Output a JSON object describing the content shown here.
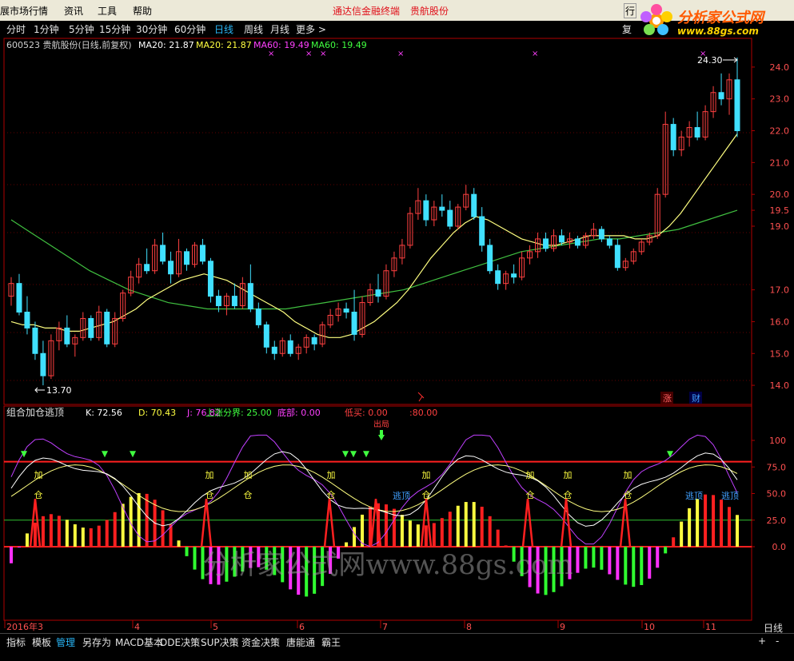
{
  "menu": {
    "items": [
      "展市场行情",
      "资讯",
      "工具",
      "帮助"
    ],
    "center_title": "通达信金融终端",
    "stock_name": "贵航股份",
    "right_label": "行"
  },
  "logo": {
    "line1": "分析家公式网",
    "line2": "www.88gs.com"
  },
  "periods": [
    "分时",
    "1分钟",
    "5分钟",
    "15分钟",
    "30分钟",
    "60分钟",
    "日线",
    "周线",
    "月线",
    "更多 >"
  ],
  "period_selected": 6,
  "right_side_label": "复",
  "main_panel": {
    "info_code": "600523 贵航股份(日线,前复权)",
    "ma_labels": [
      {
        "text": "MA20: 21.87",
        "color": "#ffffff"
      },
      {
        "text": "MA20: 21.87",
        "color": "#ffff40"
      },
      {
        "text": "MA60: 19.49",
        "color": "#ff40ff"
      },
      {
        "text": "MA60: 19.49",
        "color": "#40ff40"
      }
    ],
    "high_label": "24.30",
    "low_label": "13.70",
    "y_ticks": [
      "24.0",
      "23.0",
      "22.0",
      "21.0",
      "20.0",
      "19.5",
      "19.0",
      "17.0",
      "16.0",
      "15.0",
      "14.0"
    ],
    "bottom_markers": [
      {
        "text": "涨",
        "color": "#ff6060"
      },
      {
        "text": "财",
        "color": "#40a0ff"
      }
    ]
  },
  "indicator_panel": {
    "name": "组合加仓逃顶",
    "labels": [
      {
        "text": "K: 72.56",
        "color": "#ffffff"
      },
      {
        "text": "D: 70.43",
        "color": "#ffff40"
      },
      {
        "text": "J: 76.82",
        "color": "#ff40ff"
      },
      {
        "text": "上涨分界: 25.00",
        "color": "#40ff40"
      },
      {
        "text": "底部: 0.00",
        "color": "#ff40ff"
      },
      {
        "text": "低买: 0.00",
        "color": "#ff4040"
      },
      {
        "text": ":80.00",
        "color": "#ff4040"
      }
    ],
    "y_ticks": [
      "100",
      "75.0",
      "50.0",
      "25.0",
      "0.0"
    ],
    "signal_add": "加",
    "signal_cang": "仓",
    "signal_escape": "逃顶",
    "top_marker": "出局",
    "watermark": "分析家公式网www.88gs.com"
  },
  "date_axis": {
    "labels": [
      "2016年3",
      "4",
      "5",
      "6",
      "7",
      "8",
      "9",
      "10",
      "11"
    ],
    "right_label": "日线"
  },
  "bottom_tabs": [
    "指标",
    "模板",
    "管理",
    "另存为",
    "MACD基本",
    "DDE决策",
    "SUP决策",
    "资金决策",
    "唐能通",
    "霸王"
  ],
  "bottom_tab_selected": 2,
  "bottom_right": [
    "+",
    "-"
  ],
  "colors": {
    "up": "#ff4040",
    "down": "#40e0ff",
    "ma20": "#ffff80",
    "ma60": "#40c040",
    "frame": "#b00000"
  },
  "chart_data": {
    "type": "candlestick",
    "title": "600523 贵航股份(日线,前复权)",
    "ylim": [
      13.6,
      24.5
    ],
    "candles": [
      {
        "o": 16.8,
        "h": 17.4,
        "l": 16.5,
        "c": 17.2
      },
      {
        "o": 17.2,
        "h": 17.5,
        "l": 16.2,
        "c": 16.3
      },
      {
        "o": 16.3,
        "h": 16.8,
        "l": 15.6,
        "c": 15.8
      },
      {
        "o": 15.8,
        "h": 16.0,
        "l": 14.8,
        "c": 15.0
      },
      {
        "o": 15.0,
        "h": 15.4,
        "l": 14.0,
        "c": 14.3
      },
      {
        "o": 14.3,
        "h": 15.6,
        "l": 14.2,
        "c": 15.4
      },
      {
        "o": 15.4,
        "h": 16.0,
        "l": 15.1,
        "c": 15.8
      },
      {
        "o": 15.8,
        "h": 16.2,
        "l": 15.2,
        "c": 15.3
      },
      {
        "o": 15.3,
        "h": 15.6,
        "l": 14.9,
        "c": 15.5
      },
      {
        "o": 15.5,
        "h": 16.3,
        "l": 15.4,
        "c": 16.1
      },
      {
        "o": 16.1,
        "h": 16.2,
        "l": 15.4,
        "c": 15.5
      },
      {
        "o": 15.5,
        "h": 16.5,
        "l": 15.4,
        "c": 16.3
      },
      {
        "o": 16.3,
        "h": 16.4,
        "l": 15.2,
        "c": 15.3
      },
      {
        "o": 15.3,
        "h": 16.3,
        "l": 15.2,
        "c": 16.1
      },
      {
        "o": 16.1,
        "h": 17.0,
        "l": 16.0,
        "c": 16.9
      },
      {
        "o": 16.9,
        "h": 17.6,
        "l": 16.8,
        "c": 17.4
      },
      {
        "o": 17.4,
        "h": 18.0,
        "l": 17.2,
        "c": 17.8
      },
      {
        "o": 17.8,
        "h": 18.3,
        "l": 17.5,
        "c": 17.6
      },
      {
        "o": 17.6,
        "h": 18.6,
        "l": 17.5,
        "c": 18.4
      },
      {
        "o": 18.4,
        "h": 18.8,
        "l": 17.8,
        "c": 17.9
      },
      {
        "o": 17.9,
        "h": 18.2,
        "l": 17.2,
        "c": 17.5
      },
      {
        "o": 17.5,
        "h": 18.6,
        "l": 17.4,
        "c": 18.2
      },
      {
        "o": 18.2,
        "h": 18.3,
        "l": 17.6,
        "c": 17.8
      },
      {
        "o": 17.8,
        "h": 18.5,
        "l": 17.7,
        "c": 18.4
      },
      {
        "o": 18.4,
        "h": 18.6,
        "l": 17.8,
        "c": 17.9
      },
      {
        "o": 17.9,
        "h": 18.0,
        "l": 16.6,
        "c": 16.8
      },
      {
        "o": 16.8,
        "h": 17.0,
        "l": 16.3,
        "c": 16.5
      },
      {
        "o": 16.5,
        "h": 16.9,
        "l": 16.2,
        "c": 16.8
      },
      {
        "o": 16.8,
        "h": 17.2,
        "l": 16.4,
        "c": 16.5
      },
      {
        "o": 16.5,
        "h": 17.4,
        "l": 16.4,
        "c": 17.2
      },
      {
        "o": 17.2,
        "h": 17.8,
        "l": 16.3,
        "c": 16.4
      },
      {
        "o": 16.4,
        "h": 16.6,
        "l": 15.8,
        "c": 15.9
      },
      {
        "o": 15.9,
        "h": 16.0,
        "l": 15.0,
        "c": 15.2
      },
      {
        "o": 15.2,
        "h": 15.4,
        "l": 14.8,
        "c": 15.0
      },
      {
        "o": 15.0,
        "h": 15.5,
        "l": 14.9,
        "c": 15.4
      },
      {
        "o": 15.4,
        "h": 15.6,
        "l": 14.9,
        "c": 15.0
      },
      {
        "o": 15.0,
        "h": 15.3,
        "l": 14.8,
        "c": 15.2
      },
      {
        "o": 15.2,
        "h": 15.6,
        "l": 15.0,
        "c": 15.5
      },
      {
        "o": 15.5,
        "h": 15.6,
        "l": 15.1,
        "c": 15.3
      },
      {
        "o": 15.3,
        "h": 16.0,
        "l": 15.2,
        "c": 15.9
      },
      {
        "o": 15.9,
        "h": 16.4,
        "l": 15.8,
        "c": 16.2
      },
      {
        "o": 16.2,
        "h": 16.6,
        "l": 16.0,
        "c": 16.4
      },
      {
        "o": 16.4,
        "h": 16.6,
        "l": 16.1,
        "c": 16.3
      },
      {
        "o": 16.3,
        "h": 17.0,
        "l": 15.4,
        "c": 15.6
      },
      {
        "o": 15.6,
        "h": 16.8,
        "l": 15.5,
        "c": 16.6
      },
      {
        "o": 16.6,
        "h": 17.2,
        "l": 16.5,
        "c": 17.0
      },
      {
        "o": 17.0,
        "h": 17.5,
        "l": 16.6,
        "c": 16.8
      },
      {
        "o": 16.8,
        "h": 17.8,
        "l": 16.7,
        "c": 17.6
      },
      {
        "o": 17.6,
        "h": 18.2,
        "l": 17.4,
        "c": 18.0
      },
      {
        "o": 18.0,
        "h": 18.6,
        "l": 17.8,
        "c": 18.4
      },
      {
        "o": 18.4,
        "h": 19.6,
        "l": 18.3,
        "c": 19.4
      },
      {
        "o": 19.4,
        "h": 20.2,
        "l": 19.2,
        "c": 19.8
      },
      {
        "o": 19.8,
        "h": 20.0,
        "l": 19.0,
        "c": 19.2
      },
      {
        "o": 19.2,
        "h": 19.8,
        "l": 19.0,
        "c": 19.6
      },
      {
        "o": 19.6,
        "h": 20.0,
        "l": 19.3,
        "c": 19.5
      },
      {
        "o": 19.5,
        "h": 19.8,
        "l": 18.9,
        "c": 19.0
      },
      {
        "o": 19.0,
        "h": 19.7,
        "l": 18.9,
        "c": 19.6
      },
      {
        "o": 19.6,
        "h": 20.3,
        "l": 19.5,
        "c": 20.0
      },
      {
        "o": 20.0,
        "h": 20.2,
        "l": 19.2,
        "c": 19.3
      },
      {
        "o": 19.3,
        "h": 19.6,
        "l": 18.2,
        "c": 18.4
      },
      {
        "o": 18.4,
        "h": 18.6,
        "l": 17.5,
        "c": 17.6
      },
      {
        "o": 17.6,
        "h": 17.8,
        "l": 17.0,
        "c": 17.2
      },
      {
        "o": 17.2,
        "h": 17.6,
        "l": 17.0,
        "c": 17.5
      },
      {
        "o": 17.5,
        "h": 17.8,
        "l": 17.2,
        "c": 17.4
      },
      {
        "o": 17.4,
        "h": 18.2,
        "l": 17.3,
        "c": 18.0
      },
      {
        "o": 18.0,
        "h": 18.4,
        "l": 17.8,
        "c": 18.2
      },
      {
        "o": 18.2,
        "h": 18.8,
        "l": 18.0,
        "c": 18.6
      },
      {
        "o": 18.6,
        "h": 18.8,
        "l": 18.2,
        "c": 18.3
      },
      {
        "o": 18.3,
        "h": 18.9,
        "l": 18.2,
        "c": 18.7
      },
      {
        "o": 18.7,
        "h": 18.9,
        "l": 18.4,
        "c": 18.5
      },
      {
        "o": 18.5,
        "h": 18.8,
        "l": 18.3,
        "c": 18.6
      },
      {
        "o": 18.6,
        "h": 18.7,
        "l": 18.3,
        "c": 18.4
      },
      {
        "o": 18.4,
        "h": 18.8,
        "l": 18.3,
        "c": 18.7
      },
      {
        "o": 18.7,
        "h": 19.1,
        "l": 18.6,
        "c": 18.9
      },
      {
        "o": 18.9,
        "h": 19.0,
        "l": 18.5,
        "c": 18.6
      },
      {
        "o": 18.6,
        "h": 18.7,
        "l": 18.3,
        "c": 18.4
      },
      {
        "o": 18.4,
        "h": 18.6,
        "l": 17.6,
        "c": 17.7
      },
      {
        "o": 17.7,
        "h": 18.0,
        "l": 17.6,
        "c": 17.9
      },
      {
        "o": 17.9,
        "h": 18.3,
        "l": 17.8,
        "c": 18.2
      },
      {
        "o": 18.2,
        "h": 18.6,
        "l": 18.1,
        "c": 18.5
      },
      {
        "o": 18.5,
        "h": 18.8,
        "l": 18.4,
        "c": 18.7
      },
      {
        "o": 18.7,
        "h": 20.2,
        "l": 18.6,
        "c": 20.0
      },
      {
        "o": 20.0,
        "h": 22.6,
        "l": 19.9,
        "c": 22.2
      },
      {
        "o": 22.2,
        "h": 22.4,
        "l": 21.2,
        "c": 21.4
      },
      {
        "o": 21.4,
        "h": 22.0,
        "l": 21.2,
        "c": 21.8
      },
      {
        "o": 21.8,
        "h": 22.3,
        "l": 21.5,
        "c": 22.1
      },
      {
        "o": 22.1,
        "h": 22.6,
        "l": 21.7,
        "c": 21.8
      },
      {
        "o": 21.8,
        "h": 22.8,
        "l": 21.7,
        "c": 22.6
      },
      {
        "o": 22.6,
        "h": 23.4,
        "l": 22.4,
        "c": 23.2
      },
      {
        "o": 23.2,
        "h": 23.8,
        "l": 22.8,
        "c": 23.0
      },
      {
        "o": 23.0,
        "h": 23.8,
        "l": 22.5,
        "c": 23.6
      },
      {
        "o": 23.6,
        "h": 24.3,
        "l": 21.8,
        "c": 22.0
      }
    ],
    "series": [
      {
        "name": "MA20",
        "values": [
          16.0,
          15.9,
          15.9,
          15.8,
          15.8,
          15.7,
          15.7,
          15.8,
          15.9,
          16.0,
          16.2,
          16.4,
          16.7,
          16.9,
          17.1,
          17.3,
          17.4,
          17.5,
          17.4,
          17.3,
          17.1,
          16.9,
          16.7,
          16.5,
          16.3,
          16.0,
          15.8,
          15.6,
          15.5,
          15.5,
          15.6,
          15.8,
          16.0,
          16.3,
          16.6,
          17.0,
          17.5,
          18.0,
          18.4,
          18.8,
          19.1,
          19.3,
          19.2,
          19.0,
          18.8,
          18.6,
          18.5,
          18.4,
          18.4,
          18.5,
          18.6,
          18.7,
          18.7,
          18.7,
          18.7,
          18.6,
          18.6,
          18.7,
          19.0,
          19.4,
          19.9,
          20.4,
          20.9,
          21.4,
          21.9
        ]
      },
      {
        "name": "MA60",
        "values": [
          19.2,
          18.8,
          18.4,
          18.0,
          17.6,
          17.3,
          17.0,
          16.8,
          16.6,
          16.5,
          16.4,
          16.4,
          16.4,
          16.4,
          16.4,
          16.5,
          16.6,
          16.7,
          16.8,
          16.9,
          17.0,
          17.2,
          17.4,
          17.6,
          17.8,
          18.0,
          18.2,
          18.3,
          18.4,
          18.5,
          18.6,
          18.6,
          18.7,
          18.8,
          18.9,
          19.1,
          19.3,
          19.5
        ]
      }
    ]
  }
}
